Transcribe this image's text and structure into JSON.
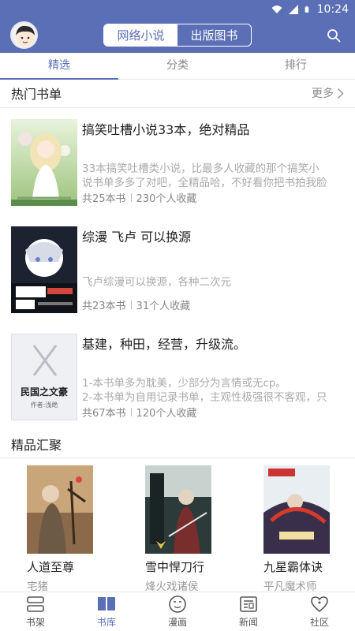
{
  "status_bar": {
    "time": "10:24"
  },
  "header": {
    "segment_left": "网络小说",
    "segment_right": "出版图书"
  },
  "tabs": [
    {
      "label": "精选"
    },
    {
      "label": "分类"
    },
    {
      "label": "排行"
    }
  ],
  "hot_lists": {
    "title": "热门书单",
    "more": "更多",
    "items": [
      {
        "title": "搞笑吐槽小说33本，绝对精品",
        "desc_line1": "33本搞笑吐槽类小说，比最多人收藏的那个搞笑小",
        "desc_line2": "说书单多多了对吧，全精品哈，不好看你把书拍我脸",
        "count": "共25本书",
        "favorites": "230个人收藏"
      },
      {
        "title": "综漫 飞卢 可以换源",
        "desc_line1": "飞卢综漫可以换源，各种二次元",
        "count": "共23本书",
        "favorites": "31个人收藏"
      },
      {
        "title": "基建，种田，经营，升级流。",
        "desc_line1": "1-本书单多为耽美，少部分为言情或无cp。",
        "desc_line2": "2-本书单为自用记录书单，主观性极强很不客观，只",
        "count": "共67本书",
        "favorites": "120个人收藏",
        "cover_text": "民国之文豪",
        "cover_sub": "作者:浅绝"
      }
    ]
  },
  "featured": {
    "title": "精品汇聚",
    "items": [
      {
        "title": "人道至尊",
        "author": "宅猪"
      },
      {
        "title": "雪中悍刀行",
        "author": "烽火戏诸侯"
      },
      {
        "title": "九星霸体诀",
        "author": "平凡魔术师"
      }
    ]
  },
  "bottom_nav": [
    {
      "label": "书架",
      "icon": "bookshelf-icon"
    },
    {
      "label": "书库",
      "icon": "open-book-icon"
    },
    {
      "label": "漫画",
      "icon": "comic-icon"
    },
    {
      "label": "新闻",
      "icon": "news-icon"
    },
    {
      "label": "社区",
      "icon": "community-icon"
    }
  ],
  "colors": {
    "accent": "#5b6fb6",
    "muted": "#888888",
    "desc": "#aaaaaa"
  }
}
